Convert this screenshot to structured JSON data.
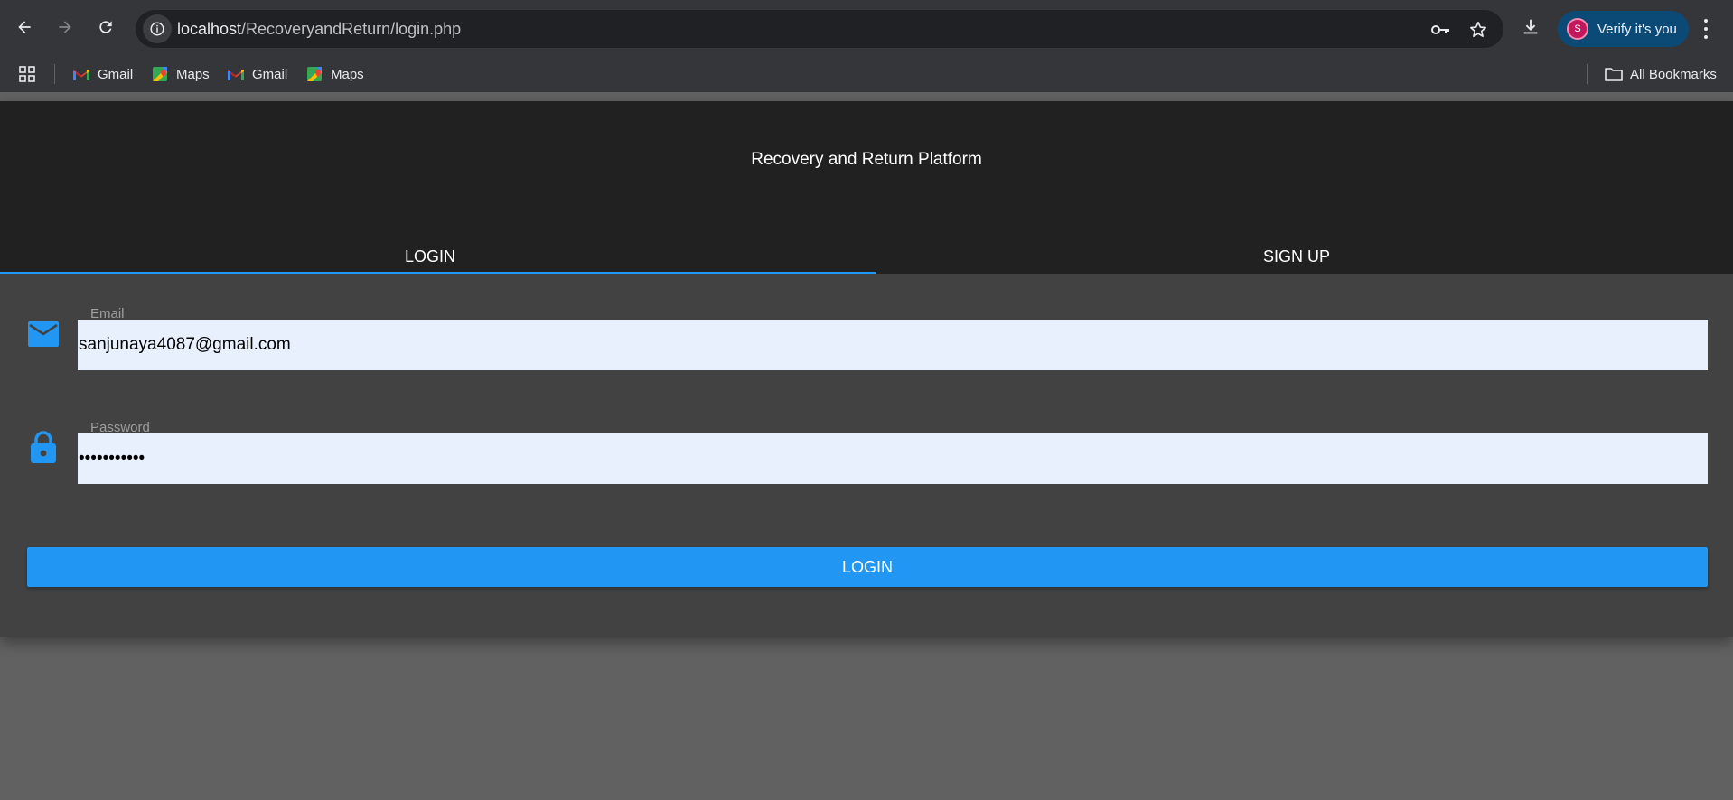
{
  "browser": {
    "url_host": "localhost",
    "url_path": "/RecoveryandReturn/login.php",
    "verify_label": "Verify it's you",
    "avatar_initial": "S",
    "bookmarks": [
      {
        "label": "Gmail",
        "icon": "gmail-icon"
      },
      {
        "label": "Maps",
        "icon": "maps-icon"
      },
      {
        "label": "Gmail",
        "icon": "gmail-icon"
      },
      {
        "label": "Maps",
        "icon": "maps-icon"
      }
    ],
    "all_bookmarks_label": "All Bookmarks"
  },
  "app": {
    "title": "Recovery and Return Platform",
    "tabs": [
      {
        "label": "LOGIN",
        "active": true
      },
      {
        "label": "SIGN UP",
        "active": false
      }
    ],
    "email": {
      "label": "Email",
      "value": "sanjunaya4087@gmail.com",
      "icon": "mail-icon"
    },
    "password": {
      "label": "Password",
      "value": "•••••••••••",
      "icon": "lock-icon"
    },
    "login_button": "LOGIN",
    "accent_color": "#2196f3"
  }
}
